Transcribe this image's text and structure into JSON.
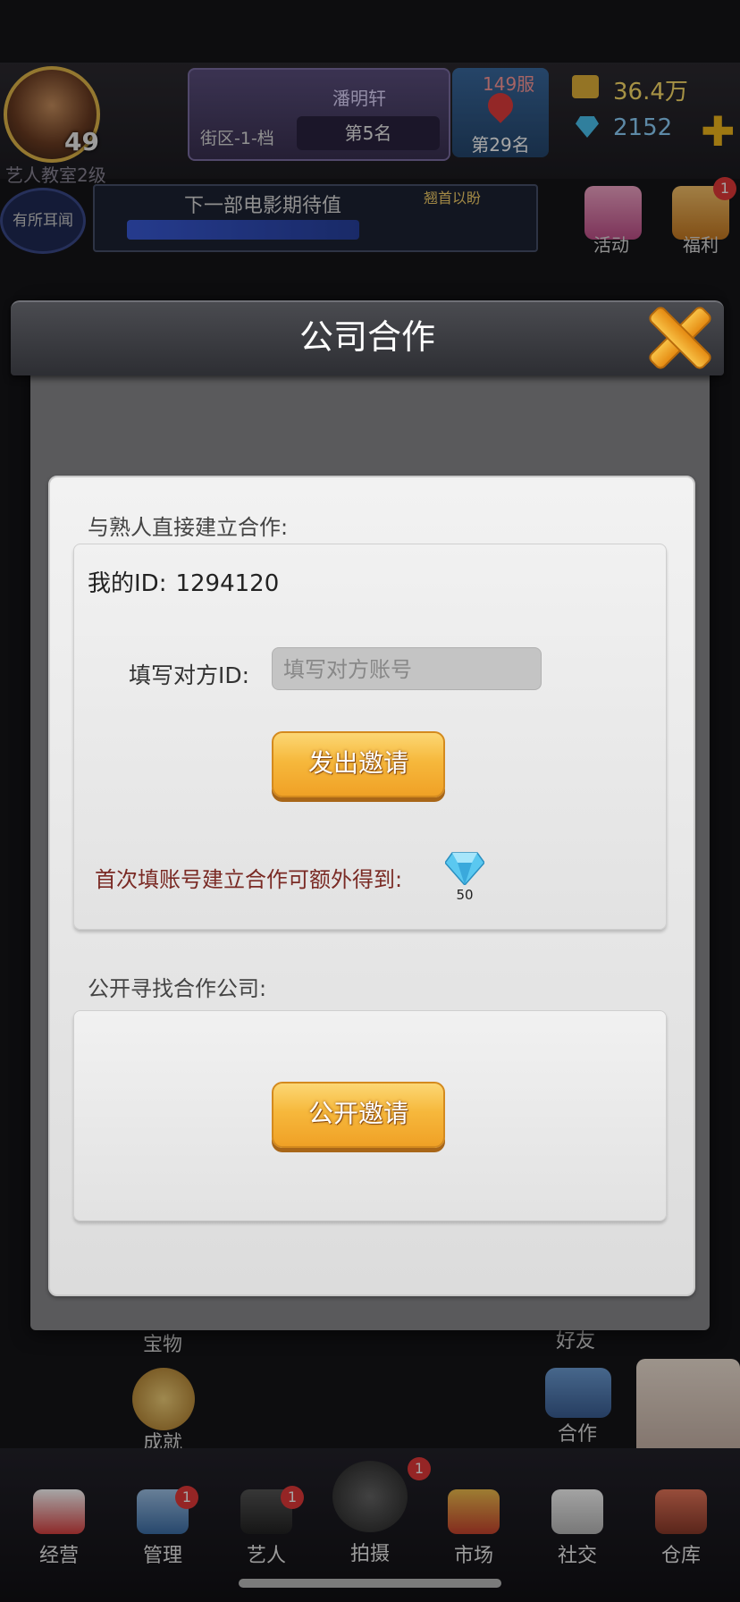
{
  "hud": {
    "level": "49",
    "studio_label": "艺人教室2级",
    "district_name": "潘明轩",
    "district_area": "街区-1-档",
    "district_rank": "第5名",
    "server": "149服",
    "server_rank": "第29名",
    "money": "36.4万",
    "gems": "2152",
    "gossip": "有所耳闻",
    "expect_label": "下一部电影期待值",
    "expect_tag": "翘首以盼",
    "activity": "活动",
    "welfare": "福利",
    "welfare_badge": "1",
    "expect_fill": 0.62
  },
  "dialog": {
    "title": "公司合作",
    "direct_section": "与熟人直接建立合作:",
    "my_id_label": "我的ID:",
    "my_id_value": "1294120",
    "fill_label": "填写对方ID:",
    "input_placeholder": "填写对方账号",
    "send_button": "发出邀请",
    "bonus_text": "首次填账号建立合作可额外得到:",
    "bonus_amount": "50",
    "public_section": "公开寻找合作公司:",
    "public_button": "公开邀请"
  },
  "background": {
    "treasure": "宝物",
    "achievement": "成就",
    "friends": "好友",
    "cooperate": "合作"
  },
  "nav": [
    {
      "label": "经营"
    },
    {
      "label": "管理",
      "badge": "1"
    },
    {
      "label": "艺人",
      "badge": "1"
    },
    {
      "label": "拍摄",
      "badge": "1"
    },
    {
      "label": "市场"
    },
    {
      "label": "社交"
    },
    {
      "label": "仓库"
    }
  ],
  "colors": {
    "button_gold": "#f6b83c",
    "bonus_text": "#7a2a24",
    "close_orange": "#f8c146"
  }
}
